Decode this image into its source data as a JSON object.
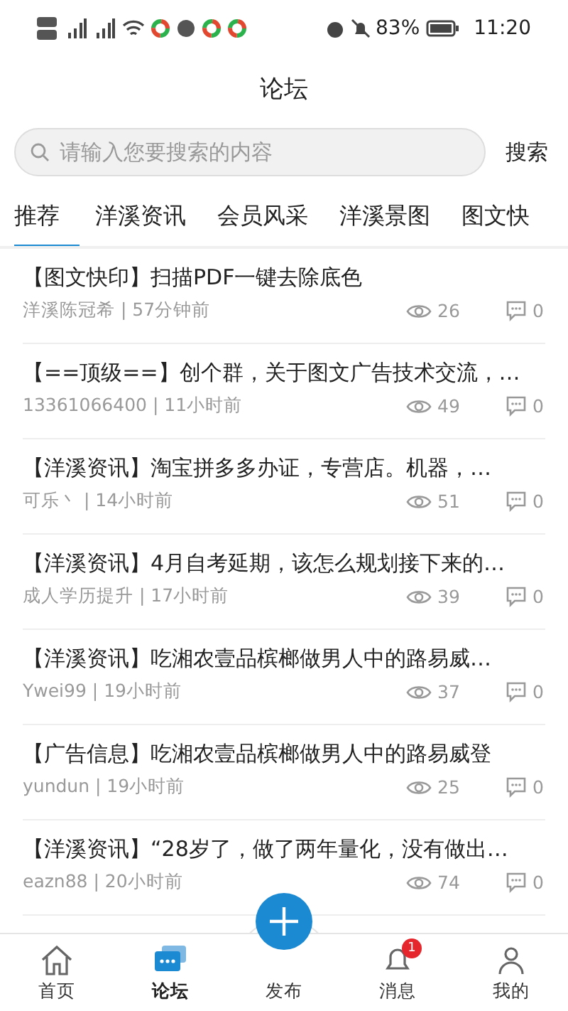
{
  "status_bar": {
    "battery": "83%",
    "time": "11:20"
  },
  "header": {
    "title": "论坛"
  },
  "search": {
    "placeholder": "请输入您要搜索的内容",
    "button": "搜索"
  },
  "tabs": [
    {
      "label": "推荐",
      "selected": true
    },
    {
      "label": "洋溪资讯",
      "selected": false
    },
    {
      "label": "会员风采",
      "selected": false
    },
    {
      "label": "洋溪景图",
      "selected": false
    },
    {
      "label": "图文快",
      "selected": false
    }
  ],
  "posts": [
    {
      "title": "【图文快印】扫描PDF一键去除底色",
      "author": "洋溪陈冠希 | 57分钟前",
      "views": "26",
      "comments": "0"
    },
    {
      "title": "【==顶级==】创个群，关于图文广告技术交流，…",
      "author": "13361066400 | 11小时前",
      "views": "49",
      "comments": "0"
    },
    {
      "title": "【洋溪资讯】淘宝拼多多办证，专营店。机器，…",
      "author": "可乐丶 | 14小时前",
      "views": "51",
      "comments": "0"
    },
    {
      "title": "【洋溪资讯】4月自考延期，该怎么规划接下来的…",
      "author": "成人学历提升 | 17小时前",
      "views": "39",
      "comments": "0"
    },
    {
      "title": "【洋溪资讯】吃湘农壹品槟榔做男人中的路易威…",
      "author": "Ywei99 | 19小时前",
      "views": "37",
      "comments": "0"
    },
    {
      "title": "【广告信息】吃湘农壹品槟榔做男人中的路易威登",
      "author": "yundun | 19小时前",
      "views": "25",
      "comments": "0"
    },
    {
      "title": "【洋溪资讯】“28岁了，做了两年量化，没有做出…",
      "author": "eazn88 | 20小时前",
      "views": "74",
      "comments": "0"
    }
  ],
  "nav": [
    {
      "kind": "home",
      "label": "首页",
      "selected": false
    },
    {
      "kind": "forum",
      "label": "论坛",
      "selected": true
    },
    {
      "kind": "publish",
      "label": "发布",
      "selected": false
    },
    {
      "kind": "message",
      "label": "消息",
      "selected": false,
      "badge": "1"
    },
    {
      "kind": "me",
      "label": "我的",
      "selected": false
    }
  ]
}
